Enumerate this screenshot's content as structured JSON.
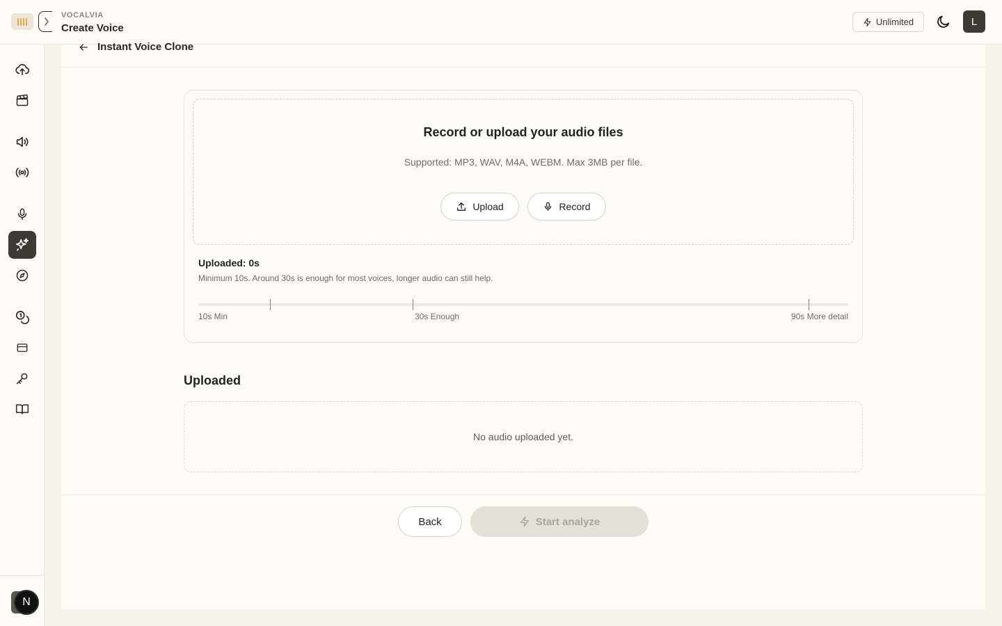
{
  "header": {
    "brand": "VOCALVIA",
    "title": "Create Voice",
    "plan_label": "Unlimited",
    "avatar_initial": "L"
  },
  "sidebar": {
    "items": [
      {
        "icon": "cloud-upload-icon",
        "active": false
      },
      {
        "icon": "clapperboard-icon",
        "active": false
      },
      {
        "icon": "speaker-icon",
        "active": false
      },
      {
        "icon": "broadcast-icon",
        "active": false
      },
      {
        "icon": "microphone-icon",
        "active": false
      },
      {
        "icon": "sparkles-icon",
        "active": true
      },
      {
        "icon": "compass-icon",
        "active": false
      },
      {
        "icon": "coins-icon",
        "active": false
      },
      {
        "icon": "credit-card-icon",
        "active": false
      },
      {
        "icon": "key-icon",
        "active": false
      },
      {
        "icon": "book-icon",
        "active": false
      }
    ],
    "footer_initial": "N"
  },
  "breadcrumb": {
    "label": "Instant Voice Clone"
  },
  "upload": {
    "title": "Record or upload your audio files",
    "subtitle": "Supported: MP3, WAV, M4A, WEBM. Max 3MB per file.",
    "upload_label": "Upload",
    "record_label": "Record"
  },
  "progress": {
    "title": "Uploaded: 0s",
    "hint": "Minimum 10s. Around 30s is enough for most voices, longer audio can still help.",
    "value_seconds": 0,
    "markers": [
      {
        "label": "10s Min",
        "seconds": 10
      },
      {
        "label": "30s Enough",
        "seconds": 30
      },
      {
        "label": "90s More detail",
        "seconds": 90
      }
    ]
  },
  "uploaded": {
    "title": "Uploaded",
    "empty_text": "No audio uploaded yet."
  },
  "actions": {
    "back_label": "Back",
    "analyze_label": "Start analyze"
  }
}
